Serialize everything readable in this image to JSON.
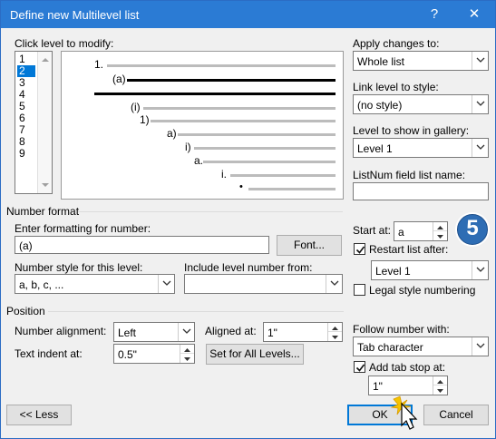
{
  "window": {
    "title": "Define new Multilevel list",
    "help": "?",
    "close": "✕"
  },
  "level": {
    "label": "Click level to modify:",
    "items": [
      "1",
      "2",
      "3",
      "4",
      "5",
      "6",
      "7",
      "8",
      "9"
    ],
    "selected_index": 1
  },
  "preview": {
    "numbers": [
      "1.",
      "(a)",
      "(i)",
      "1)",
      "a)",
      "i)",
      "a.",
      "i.",
      "•"
    ]
  },
  "apply": {
    "label": "Apply changes to:",
    "value": "Whole list"
  },
  "link": {
    "label": "Link level to style:",
    "value": "(no style)"
  },
  "gallery": {
    "label": "Level to show in gallery:",
    "value": "Level 1"
  },
  "listnum": {
    "label": "ListNum field list name:",
    "value": ""
  },
  "number_format": {
    "section": "Number format",
    "enter_label": "Enter formatting for number:",
    "enter_value": "(a)",
    "font_button": "Font...",
    "style_label": "Number style for this level:",
    "style_value": "a, b, c, ...",
    "include_label": "Include level number from:",
    "include_value": ""
  },
  "start": {
    "label": "Start at:",
    "value": "a"
  },
  "restart": {
    "label": "Restart list after:",
    "checked": true,
    "value": "Level 1"
  },
  "legal": {
    "label": "Legal style numbering",
    "checked": false
  },
  "position": {
    "section": "Position",
    "align_label": "Number alignment:",
    "align_value": "Left",
    "aligned_at_label": "Aligned at:",
    "aligned_at_value": "1\"",
    "indent_label": "Text indent at:",
    "indent_value": "0.5\"",
    "set_all_button": "Set for All Levels..."
  },
  "follow": {
    "label": "Follow number with:",
    "value": "Tab character"
  },
  "tabstop": {
    "label": "Add tab stop at:",
    "checked": true,
    "value": "1\""
  },
  "buttons": {
    "less": "<< Less",
    "ok": "OK",
    "cancel": "Cancel"
  },
  "step_badge": {
    "value": "5",
    "color": "#2e6db4"
  }
}
